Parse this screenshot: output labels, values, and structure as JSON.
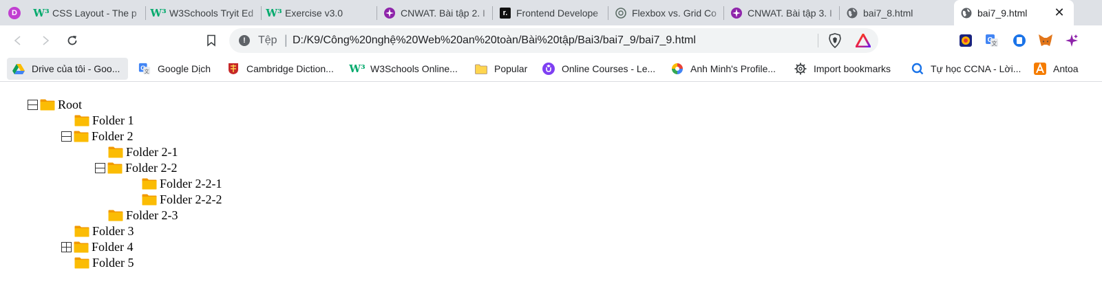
{
  "tabs": [
    {
      "id": "t0",
      "favicon": "profile-d-icon",
      "favicon_text": "D",
      "label": ""
    },
    {
      "id": "t1",
      "favicon": "w3schools-icon",
      "favicon_text": "W³",
      "label": "CSS Layout - The p"
    },
    {
      "id": "t2",
      "favicon": "w3schools-icon",
      "favicon_text": "W³",
      "label": "W3Schools Tryit Ed"
    },
    {
      "id": "t3",
      "favicon": "w3schools-icon",
      "favicon_text": "W³",
      "label": "Exercise v3.0"
    },
    {
      "id": "t4",
      "favicon": "sparkle-icon",
      "favicon_text": "",
      "label": "CNWAT. Bài tập 2. I"
    },
    {
      "id": "t5",
      "favicon": "roadmap-icon",
      "favicon_text": "r.",
      "label": "Frontend Develope"
    },
    {
      "id": "t6",
      "favicon": "chatgpt-icon",
      "favicon_text": "",
      "label": "Flexbox vs. Grid Co"
    },
    {
      "id": "t7",
      "favicon": "sparkle-icon",
      "favicon_text": "",
      "label": "CNWAT. Bài tập 3. I"
    },
    {
      "id": "t8",
      "favicon": "globe-icon",
      "favicon_text": "",
      "label": "bai7_8.html"
    },
    {
      "id": "t9",
      "favicon": "globe-icon",
      "favicon_text": "",
      "label": "bai7_9.html",
      "active": true
    }
  ],
  "toolbar": {
    "back_icon": "back-arrow-icon",
    "forward_icon": "forward-arrow-icon",
    "reload_icon": "reload-icon",
    "bookmark_icon": "bookmark-icon",
    "security_icon": "info-icon",
    "scheme_label": "Tệp",
    "url": "D:/K9/Công%20nghệ%20Web%20an%20toàn/Bài%20tập/Bai3/bai7_9/bai7_9.html",
    "brave_icon": "brave-shield-icon",
    "rewards_icon": "brave-rewards-icon"
  },
  "extensions": [
    "extension-icon-1",
    "google-translate-icon",
    "extension-icon-3",
    "metamask-icon",
    "sparkle-icon"
  ],
  "bookmarks": [
    {
      "label": "Drive của tôi - Goo...",
      "icon": "google-drive-icon"
    },
    {
      "label": "Google Dịch",
      "icon": "google-translate-icon"
    },
    {
      "label": "Cambridge Diction...",
      "icon": "cambridge-icon"
    },
    {
      "label": "W3Schools Online...",
      "icon": "w3schools-icon"
    },
    {
      "label": "Popular",
      "icon": "folder-icon"
    },
    {
      "label": "Online Courses - Le...",
      "icon": "udemy-icon"
    },
    {
      "label": "Anh Minh's Profile...",
      "icon": "swirl-icon"
    },
    {
      "label": "Import bookmarks",
      "icon": "gear-icon"
    },
    {
      "label": "Tự học CCNA - Lời...",
      "icon": "search-c-icon"
    },
    {
      "label": "Antoa",
      "icon": "a-logo-icon"
    }
  ],
  "tree": [
    {
      "label": "Root",
      "toggle": "minus",
      "level": 0
    },
    {
      "label": "Folder 1",
      "toggle": "none",
      "level": 1
    },
    {
      "label": "Folder 2",
      "toggle": "minus",
      "level": 1
    },
    {
      "label": "Folder 2-1",
      "toggle": "none",
      "level": 2
    },
    {
      "label": "Folder 2-2",
      "toggle": "minus",
      "level": 2
    },
    {
      "label": "Folder 2-2-1",
      "toggle": "none",
      "level": 3
    },
    {
      "label": "Folder 2-2-2",
      "toggle": "none",
      "level": 3
    },
    {
      "label": "Folder 2-3",
      "toggle": "none",
      "level": 2
    },
    {
      "label": "Folder 3",
      "toggle": "none",
      "level": 1
    },
    {
      "label": "Folder 4",
      "toggle": "plus",
      "level": 1
    },
    {
      "label": "Folder 5",
      "toggle": "none",
      "level": 1
    }
  ],
  "colors": {
    "tabstrip_bg": "#dee1e6",
    "omnibox_bg": "#f1f3f4",
    "folder_body": "#fbbc04",
    "folder_back": "#f29900",
    "w3_green": "#04aa6d"
  }
}
